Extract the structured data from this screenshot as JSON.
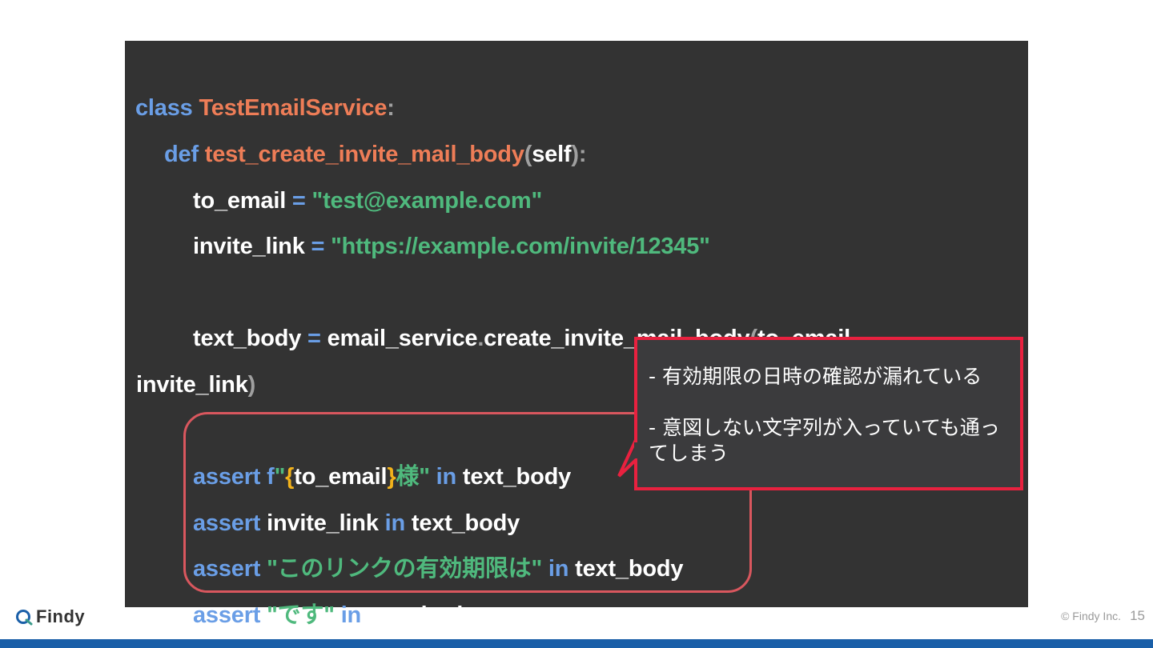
{
  "code": {
    "l1": {
      "kw": "class",
      "name": "TestEmailService",
      "colon": ":"
    },
    "l2": {
      "kw": "def",
      "name": "test_create_invite_mail_body",
      "open": "(",
      "arg": "self",
      "close": ")",
      "colon": ":"
    },
    "l3": {
      "var": "to_email",
      "eq": "=",
      "str": "\"test@example.com\""
    },
    "l4": {
      "var": "invite_link",
      "eq": "=",
      "str": "\"https://example.com/invite/12345\""
    },
    "l5": {
      "var": "text_body",
      "eq": "=",
      "obj": "email_service",
      "dot": ".",
      "method": "create_invite_mail_body",
      "open": "(",
      "arg1": "to_email",
      "comma": ","
    },
    "l6": {
      "arg2": "invite_link",
      "close": ")"
    },
    "l7": {
      "kw": "assert",
      "f": "f",
      "q1": "\"",
      "lb": "{",
      "var": "to_email",
      "rb": "}",
      "str": "様\"",
      "in": "in",
      "target": "text_body"
    },
    "l8": {
      "kw": "assert",
      "var": "invite_link",
      "in": "in",
      "target": "text_body"
    },
    "l9": {
      "kw": "assert",
      "str": "\"このリンクの有効期限は\"",
      "in": "in",
      "target": "text_body"
    },
    "l10": {
      "kw": "assert",
      "str": "\"です\"",
      "in": "in",
      "target": "text_body"
    }
  },
  "callout": {
    "point1": "- 有効期限の日時の確認が漏れている",
    "point2": "- 意図しない文字列が入っていても通ってしまう"
  },
  "footer": {
    "logo": "Findy",
    "copyright": "© Findy Inc.",
    "page": "15"
  },
  "colors": {
    "panel": "#333333",
    "keyword": "#6a9ee6",
    "function": "#ee7d57",
    "string": "#4fb97d",
    "callout_border": "#e8213f",
    "assert_border": "#d9575e",
    "bottom_bar": "#1a5fa8"
  }
}
